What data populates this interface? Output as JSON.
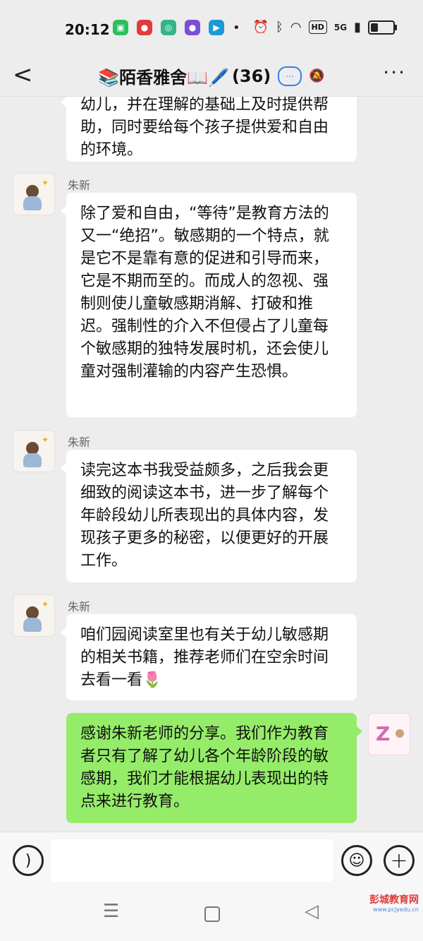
{
  "status_bar": {
    "time": "20:12",
    "network": "5G",
    "hd_label": "HD",
    "battery_level": 0.35
  },
  "header": {
    "title": "📚陌香雅舍📖🖊️",
    "member_count": "(36)"
  },
  "messages": [
    {
      "sender": "",
      "text": "幼儿，并在理解的基础上及时提供帮助，同时要给每个孩子提供爱和自由的环境。"
    },
    {
      "sender": "朱新",
      "text": "除了爱和自由，“等待”是教育方法的又一“绝招”。敏感期的一个特点，就是它不是靠有意的促进和引导而来，它是不期而至的。而成人的忽视、强制则使儿童敏感期消解、打破和推迟。强制性的介入不但侵占了儿童每个敏感期的独特发展时机，还会使儿童对强制灌输的内容产生恐惧。"
    },
    {
      "sender": "朱新",
      "text": "读完这本书我受益颇多，之后我会更细致的阅读这本书，进一步了解每个年龄段幼儿所表现出的具体内容，发现孩子更多的秘密，以便更好的开展工作。"
    },
    {
      "sender": "朱新",
      "text": "咱们园阅读室里也有关于幼儿敏感期的相关书籍，推荐老师们在空余时间去看一看🌷"
    },
    {
      "sender": "self",
      "text": "感谢朱新老师的分享。我们作为教育者只有了解了幼儿各个年龄阶段的敏感期，我们才能根据幼儿表现出的特点来进行教育。"
    }
  ],
  "watermark": {
    "title": "彭城教育网",
    "url": "www.pcjyedu.cn"
  }
}
